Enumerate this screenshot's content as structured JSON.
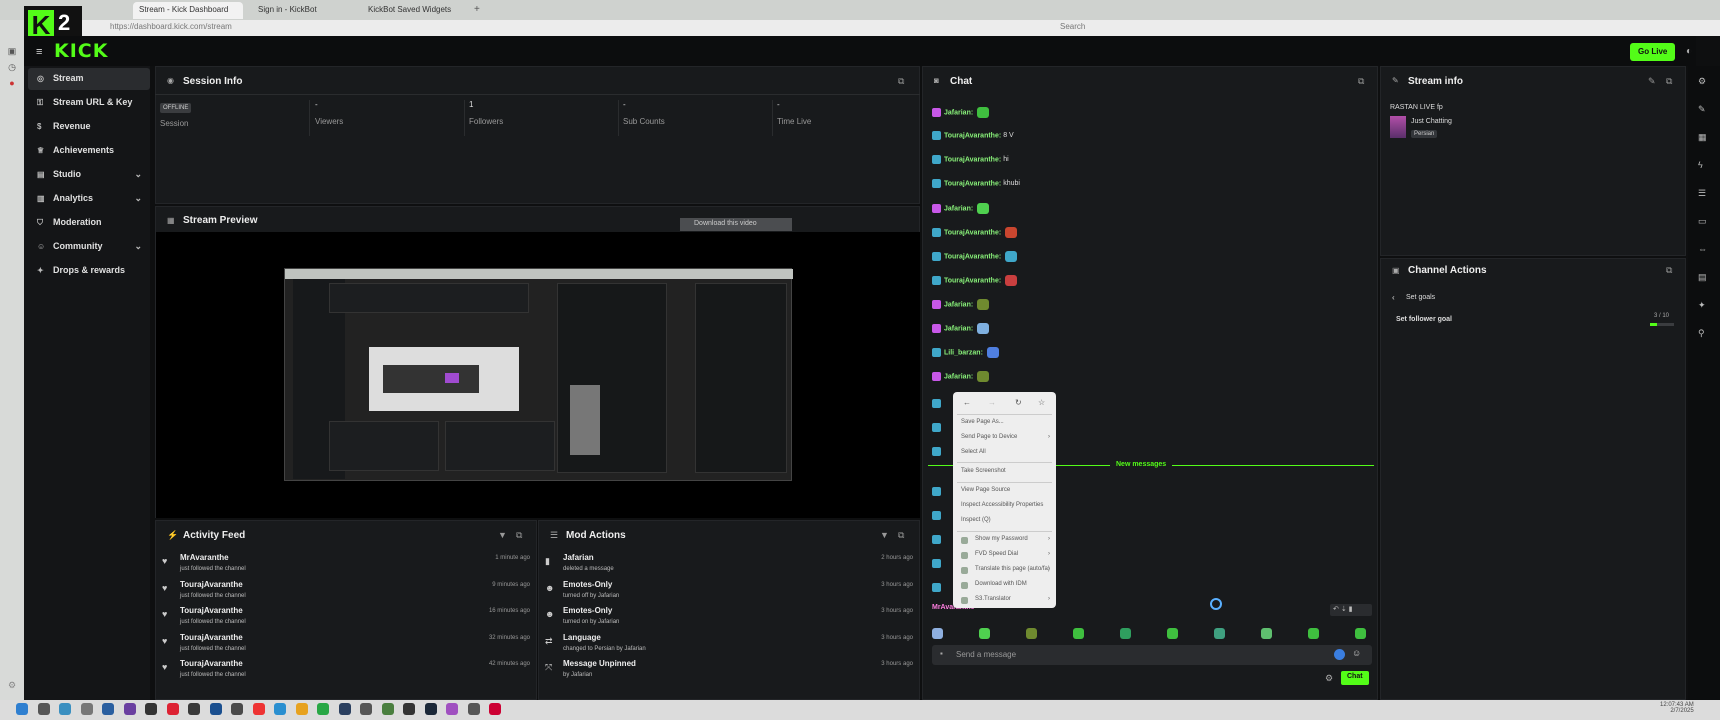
{
  "browser": {
    "tabs": [
      "Stream - Kick Dashboard",
      "Sign in - KickBot",
      "KickBot Saved Widgets"
    ],
    "url": "https://dashboard.kick.com/stream",
    "search_placeholder": "Search"
  },
  "badge": {
    "letter": "K",
    "number": "2"
  },
  "app": {
    "logo": "KICK",
    "go_live": "Go Live"
  },
  "sidebar": {
    "items": [
      {
        "label": "Stream",
        "icon": "stream-icon"
      },
      {
        "label": "Stream URL & Key",
        "icon": "key-icon"
      },
      {
        "label": "Revenue",
        "icon": "revenue-icon"
      },
      {
        "label": "Achievements",
        "icon": "trophy-icon"
      },
      {
        "label": "Studio",
        "icon": "studio-icon"
      },
      {
        "label": "Analytics",
        "icon": "analytics-icon"
      },
      {
        "label": "Moderation",
        "icon": "shield-icon"
      },
      {
        "label": "Community",
        "icon": "community-icon"
      },
      {
        "label": "Drops & rewards",
        "icon": "gift-icon"
      }
    ]
  },
  "session_info": {
    "title": "Session Info",
    "status": "OFFLINE",
    "stats": [
      {
        "value": "",
        "label": "Session"
      },
      {
        "value": "-",
        "label": "Viewers"
      },
      {
        "value": "1",
        "label": "Followers"
      },
      {
        "value": "-",
        "label": "Sub Counts"
      },
      {
        "value": "-",
        "label": "Time Live"
      }
    ]
  },
  "stream_preview": {
    "title": "Stream Preview",
    "download_label": "Download this video"
  },
  "activity_feed": {
    "title": "Activity Feed",
    "items": [
      {
        "name": "MrAvaranthe",
        "action": "just followed the channel",
        "time": "1 minute ago"
      },
      {
        "name": "TourajAvaranthe",
        "action": "just followed the channel",
        "time": "9 minutes ago"
      },
      {
        "name": "TourajAvaranthe",
        "action": "just followed the channel",
        "time": "16 minutes ago"
      },
      {
        "name": "TourajAvaranthe",
        "action": "just followed the channel",
        "time": "32 minutes ago"
      },
      {
        "name": "TourajAvaranthe",
        "action": "just followed the channel",
        "time": "42 minutes ago"
      }
    ]
  },
  "mod_actions": {
    "title": "Mod Actions",
    "items": [
      {
        "title": "Jafarian",
        "detail": "deleted a message",
        "time": "2 hours ago"
      },
      {
        "title": "Emotes-Only",
        "detail": "turned off by Jafarian",
        "time": "3 hours ago"
      },
      {
        "title": "Emotes-Only",
        "detail": "turned on by Jafarian",
        "time": "3 hours ago"
      },
      {
        "title": "Language",
        "detail": "changed to Persian by Jafarian",
        "time": "3 hours ago"
      },
      {
        "title": "Message Unpinned",
        "detail": "by Jafarian",
        "time": "3 hours ago"
      }
    ]
  },
  "chat": {
    "title": "Chat",
    "messages": [
      {
        "user": "Jafarian:",
        "text": "",
        "emote": "#3fbf3f",
        "mod": true
      },
      {
        "user": "TourajAvaranthe:",
        "text": "8 V",
        "emote": "",
        "mod": false
      },
      {
        "user": "TourajAvaranthe:",
        "text": "hi",
        "emote": "",
        "mod": false
      },
      {
        "user": "TourajAvaranthe:",
        "text": "khubi",
        "emote": "",
        "mod": false
      },
      {
        "user": "Jafarian:",
        "text": "",
        "emote": "#4fd04f",
        "mod": true
      },
      {
        "user": "TourajAvaranthe:",
        "text": "",
        "emote": "#c9462f",
        "mod": false
      },
      {
        "user": "TourajAvaranthe:",
        "text": "",
        "emote": "#3fa7c9",
        "mod": false
      },
      {
        "user": "TourajAvaranthe:",
        "text": "",
        "emote": "#c93f3f",
        "mod": false
      },
      {
        "user": "Jafarian:",
        "text": "",
        "emote": "#6f8a2f",
        "mod": true
      },
      {
        "user": "Jafarian:",
        "text": "",
        "emote": "#7fb0e0",
        "mod": true
      },
      {
        "user": "Lili_barzan:",
        "text": "",
        "emote": "#4f7fe0",
        "mod": false
      },
      {
        "user": "Jafarian:",
        "text": "",
        "emote": "#6f8a2f",
        "mod": true
      }
    ],
    "new_messages_label": "New messages",
    "last_user": "MrAvaranthe",
    "send_placeholder": "Send a message",
    "chat_button": "Chat"
  },
  "context_menu": {
    "items": [
      "Save Page As...",
      "Send Page to Device",
      "Select All",
      "Take Screenshot",
      "View Page Source",
      "Inspect Accessibility Properties",
      "Inspect (Q)",
      "Show my Password",
      "FVD Speed Dial",
      "Translate this page (auto/fa)",
      "Download with IDM",
      "S3.Translator"
    ]
  },
  "stream_info": {
    "title": "Stream info",
    "stream_title": "RASTAN LIVE fp",
    "category": "Just Chatting",
    "language": "Persian"
  },
  "channel_actions": {
    "title": "Channel Actions",
    "back_label": "Set goals",
    "goal_label": "Set follower goal",
    "goal_progress": "3 / 10",
    "goal_fraction": 0.3
  },
  "colors": {
    "accent": "#53fc18",
    "bg": "#0e0f10",
    "panel": "#181a1c"
  },
  "taskbar": {
    "time": "12:07:43 AM",
    "date": "2/7/2025"
  }
}
